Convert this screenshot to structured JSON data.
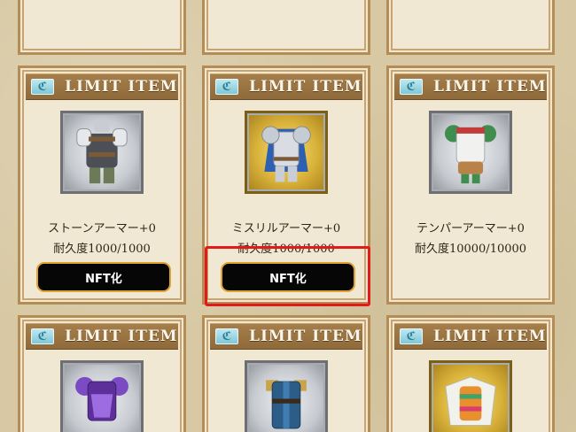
{
  "header_label": "LIMIT ITEM",
  "tag_icon_glyph": "ℭ",
  "highlight_color": "#e21a1a",
  "rows": [
    {
      "items": [
        {
          "name": "ストーンアーマー+0",
          "durability": "耐久度1000/1000",
          "button": "NFT化",
          "icon": "stone-armor-icon",
          "frame": "silver"
        },
        {
          "name": "ミスリルアーマー+0",
          "durability": "耐久度1000/1000",
          "button": "NFT化",
          "icon": "mithril-armor-icon",
          "frame": "gold",
          "highlighted": true
        },
        {
          "name": "テンパーアーマー+0",
          "durability": "耐久度10000/10000",
          "button": "",
          "icon": "temper-armor-icon",
          "frame": "silver"
        }
      ]
    },
    {
      "items": [
        {
          "icon": "purple-armor-icon",
          "frame": "silver"
        },
        {
          "icon": "blue-coat-armor-icon",
          "frame": "silver"
        },
        {
          "icon": "feather-armor-icon",
          "frame": "gold"
        }
      ]
    }
  ]
}
